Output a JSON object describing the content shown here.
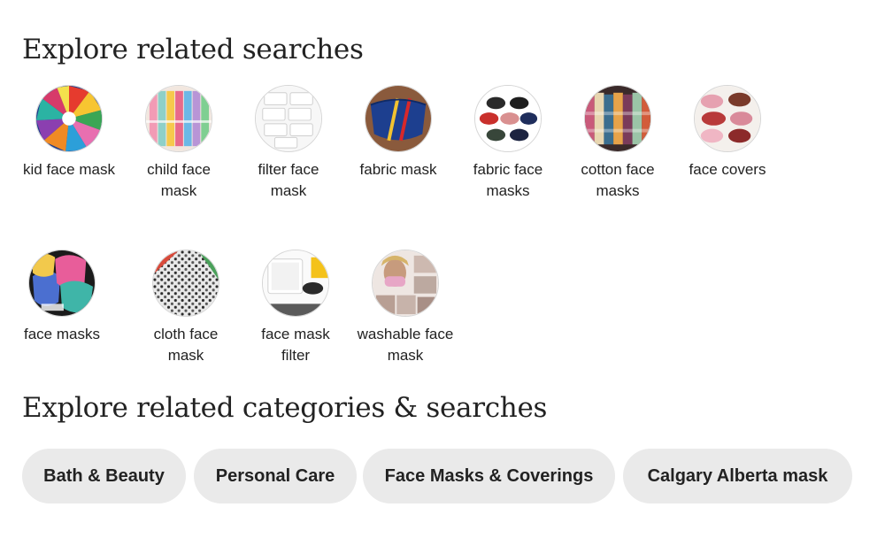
{
  "related_searches": {
    "heading": "Explore related searches",
    "items": [
      {
        "label": "kid face mask",
        "icon": "kid-face-mask-thumbnail"
      },
      {
        "label": "child face mask",
        "icon": "child-face-mask-thumbnail"
      },
      {
        "label": "filter face mask",
        "icon": "filter-face-mask-thumbnail"
      },
      {
        "label": "fabric mask",
        "icon": "fabric-mask-thumbnail"
      },
      {
        "label": "fabric face masks",
        "icon": "fabric-face-masks-thumbnail"
      },
      {
        "label": "cotton face masks",
        "icon": "cotton-face-masks-thumbnail"
      },
      {
        "label": "face covers",
        "icon": "face-covers-thumbnail"
      },
      {
        "label": "face masks",
        "icon": "face-masks-thumbnail"
      },
      {
        "label": "cloth face mask",
        "icon": "cloth-face-mask-thumbnail"
      },
      {
        "label": "face mask filter",
        "icon": "face-mask-filter-thumbnail"
      },
      {
        "label": "washable face mask",
        "icon": "washable-face-mask-thumbnail"
      }
    ]
  },
  "related_categories": {
    "heading": "Explore related categories & searches",
    "chips": [
      {
        "label": "Bath & Beauty"
      },
      {
        "label": "Personal Care"
      },
      {
        "label": "Face Masks & Coverings"
      },
      {
        "label": "Calgary Alberta mask"
      }
    ]
  },
  "colors": {
    "text": "#222222",
    "chip_background": "#eaeaea",
    "thumbnail_border": "#d6d6d6"
  }
}
